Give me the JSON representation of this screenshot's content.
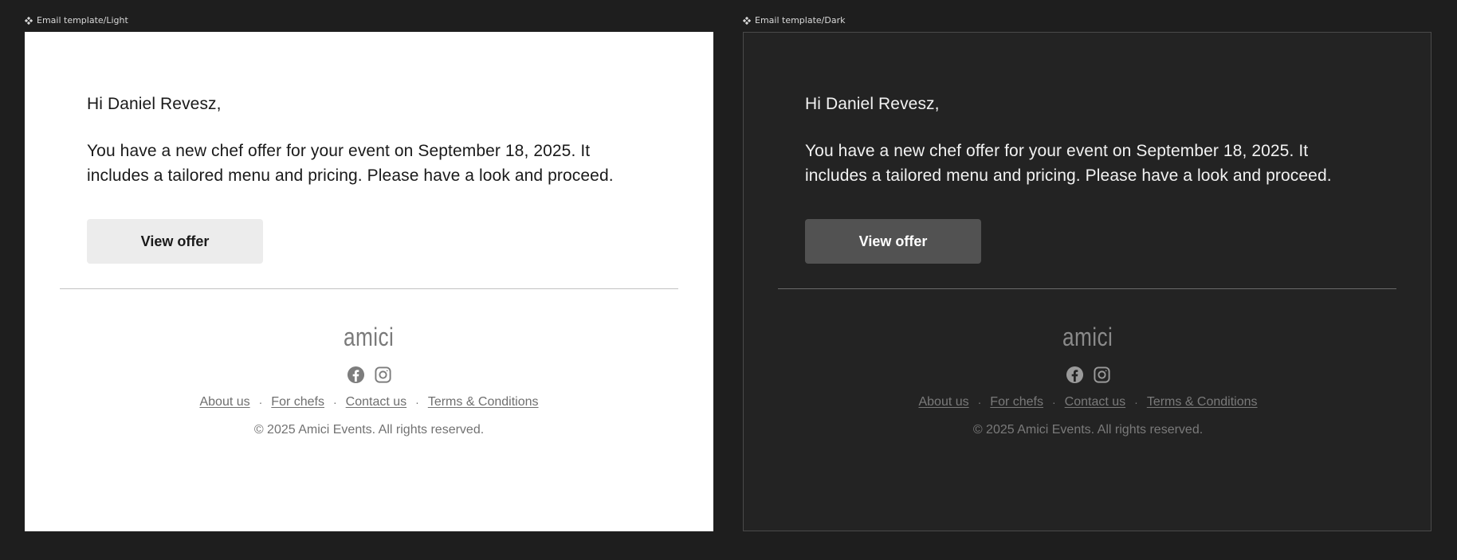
{
  "frames": [
    {
      "label": "Email template/Light",
      "theme": "light",
      "greeting": "Hi Daniel Revesz,",
      "message": "You have a new chef offer for your event on September 18, 2025. It includes a tailored menu and pricing. Please have a look and proceed.",
      "cta_label": "View offer",
      "logo": "amici",
      "social_icons": [
        "facebook-icon",
        "instagram-icon"
      ],
      "links": [
        "About us",
        "For chefs",
        "Contact us",
        "Terms & Conditions"
      ],
      "separator": "·",
      "copyright": "© 2025 Amici Events. All rights reserved."
    },
    {
      "label": "Email template/Dark",
      "theme": "dark",
      "greeting": "Hi Daniel Revesz,",
      "message": "You have a new chef offer for your event on September 18, 2025. It includes a tailored menu and pricing. Please have a look and proceed.",
      "cta_label": "View offer",
      "logo": "amici",
      "social_icons": [
        "facebook-icon",
        "instagram-icon"
      ],
      "links": [
        "About us",
        "For chefs",
        "Contact us",
        "Terms & Conditions"
      ],
      "separator": "·",
      "copyright": "© 2025 Amici Events. All rights reserved."
    }
  ],
  "colors": {
    "canvas_bg": "#1e1e1e",
    "light_bg": "#ffffff",
    "dark_bg": "#232323",
    "light_button": "#ececec",
    "dark_button": "#525252"
  }
}
